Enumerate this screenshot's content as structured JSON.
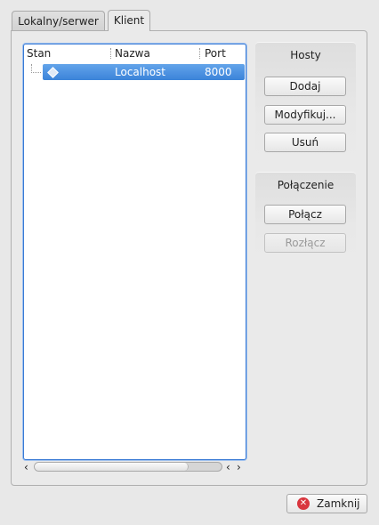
{
  "tabs": [
    {
      "label": "Lokalny/serwer",
      "active": false
    },
    {
      "label": "Klient",
      "active": true
    }
  ],
  "hosts_table": {
    "columns": [
      "Stan",
      "Nazwa",
      "Port"
    ],
    "rows": [
      {
        "stan": "",
        "nazwa": "Localhost",
        "port": "8000",
        "selected": true
      }
    ]
  },
  "hosts_group": {
    "title": "Hosty",
    "add": "Dodaj",
    "modify": "Modyfikuj...",
    "remove": "Usuń"
  },
  "connection_group": {
    "title": "Połączenie",
    "connect": "Połącz",
    "disconnect": "Rozłącz"
  },
  "close_button": "Zamknij",
  "colors": {
    "selection": "#3b83d9",
    "focus_border": "#3a7bd5",
    "close_icon": "#d9363e"
  }
}
